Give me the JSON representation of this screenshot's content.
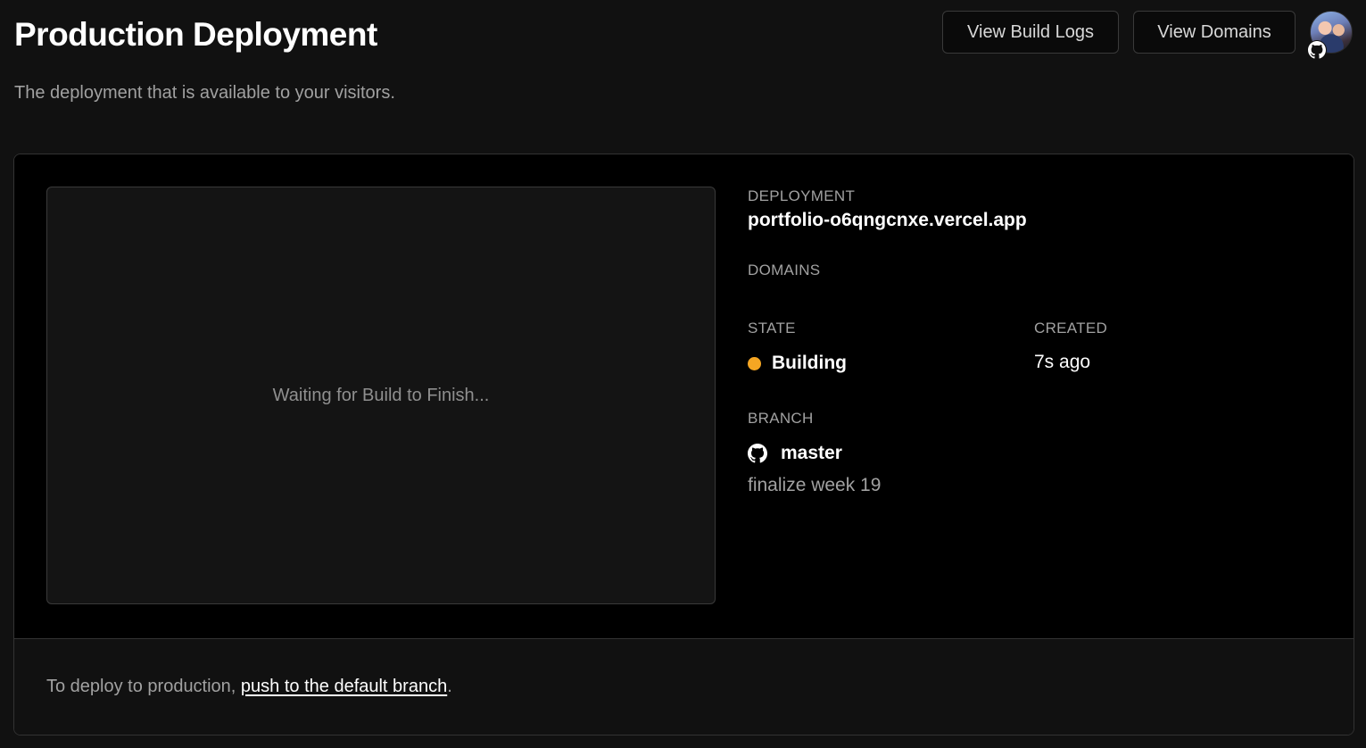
{
  "header": {
    "title": "Production Deployment",
    "subtitle": "The deployment that is available to your visitors.",
    "build_logs_label": "View Build Logs",
    "domains_label": "View Domains"
  },
  "preview": {
    "status_text": "Waiting for Build to Finish..."
  },
  "details": {
    "deployment_label": "DEPLOYMENT",
    "deployment_url": "portfolio-o6qngcnxe.vercel.app",
    "domains_label": "DOMAINS",
    "state_label": "STATE",
    "state_value": "Building",
    "state_color": "#f5a623",
    "created_label": "CREATED",
    "created_value": "7s ago",
    "branch_label": "BRANCH",
    "branch_name": "master",
    "branch_icon": "github-icon",
    "commit_message": "finalize week 19"
  },
  "footer": {
    "text_before": "To deploy to production, ",
    "link_text": "push to the default branch",
    "text_after": "."
  }
}
